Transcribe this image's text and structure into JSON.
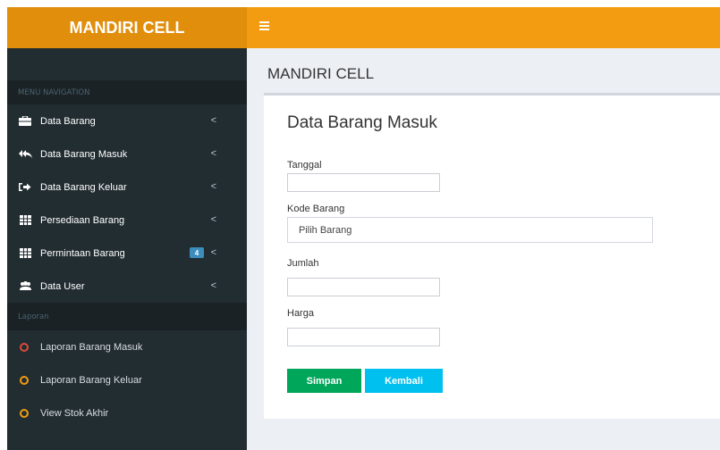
{
  "header": {
    "logo": "MANDIRI CELL"
  },
  "sidebar": {
    "nav_header": "MENU NAVIGATION",
    "items": [
      {
        "label": "Data Barang",
        "icon": "briefcase-icon"
      },
      {
        "label": "Data Barang Masuk",
        "icon": "reply-all-icon"
      },
      {
        "label": "Data Barang Keluar",
        "icon": "sign-out-icon"
      },
      {
        "label": "Persediaan Barang",
        "icon": "table-icon"
      },
      {
        "label": "Permintaan Barang",
        "icon": "table-icon",
        "badge": "4"
      },
      {
        "label": "Data User",
        "icon": "users-icon"
      }
    ],
    "report_header": "Laporan",
    "reports": [
      {
        "label": "Laporan Barang Masuk",
        "color": "#dd4b39"
      },
      {
        "label": "Laporan Barang Keluar",
        "color": "#f39c12"
      },
      {
        "label": "View Stok Akhir",
        "color": "#f39c12"
      }
    ],
    "arrow": "<"
  },
  "content": {
    "page_title": "MANDIRI CELL",
    "box_title": "Data Barang Masuk",
    "fields": {
      "tanggal_label": "Tanggal",
      "kode_label": "Kode Barang",
      "kode_value": "Pilih Barang",
      "jumlah_label": "Jumlah",
      "harga_label": "Harga"
    },
    "buttons": {
      "save": "Simpan",
      "back": "Kembali"
    }
  },
  "colors": {
    "brand": "#f39c12",
    "sidebar": "#222d32",
    "save": "#00a65a",
    "back": "#00c0ef"
  }
}
